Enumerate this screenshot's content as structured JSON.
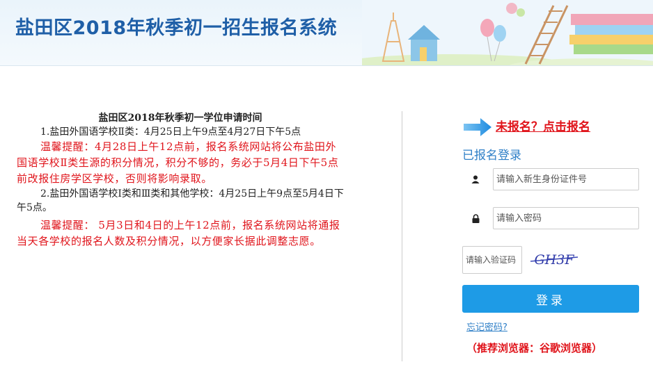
{
  "header": {
    "title": "盐田区2018年秋季初一招生报名系统"
  },
  "notice": {
    "title": "盐田区2018年秋季初一学位申请时间",
    "item1": "1.盐田外国语学校Ⅱ类：4月25日上午9点至4月27日下午5点",
    "warn1": "温馨提醒：4月28日上午12点前，报名系统网站将公布盐田外国语学校Ⅱ类生源的积分情况，积分不够的，务必于5月4日下午5点前改报住房学区学校，否则将影响录取。",
    "item2": "2.盐田外国语学校Ⅰ类和Ⅲ类和其他学校：4月25日上午9点至5月4日下午5点。",
    "warn2": "温馨提醒： 5月3日和4日的上午12点前，报名系统网站将通报当天各学校的报名人数及积分情况，以方便家长据此调整志愿。"
  },
  "login": {
    "register_link": "未报名？点击报名",
    "title": "已报名登录",
    "id_placeholder": "请输入新生身份证件号",
    "password_placeholder": "请输入密码",
    "captcha_placeholder": "请输入验证码",
    "captcha_text": "GH3F",
    "login_button": "登录",
    "forgot_link": "忘记密码?",
    "browser_tip": "（推荐浏览器：谷歌浏览器）"
  },
  "colors": {
    "title_blue": "#1f5fa7",
    "accent_blue": "#1e9be6",
    "warning_red": "#e0141b"
  },
  "icons": {
    "user": "user-icon",
    "lock": "lock-icon",
    "arrow": "arrow-right-icon"
  }
}
